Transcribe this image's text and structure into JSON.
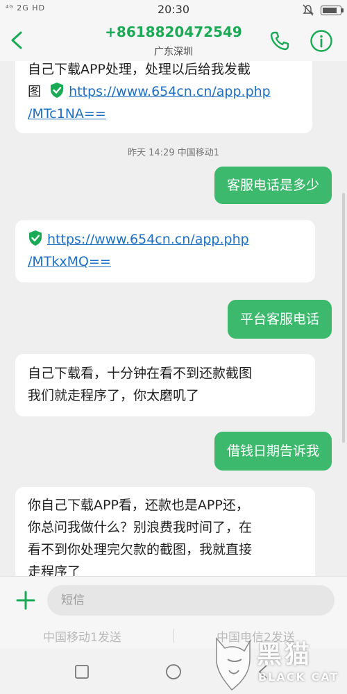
{
  "status": {
    "network": "⁴ᴳ 2G HD",
    "time": "20:30"
  },
  "header": {
    "title": "+8618820472549",
    "subtitle": "广东深圳"
  },
  "messages": [
    {
      "dir": "in",
      "lines": [
        "自己下载APP处理，处理以后给我发截"
      ],
      "link_prefix": "图",
      "link": [
        "https://www.654cn.cn/app.php",
        "/MTc1NA=="
      ]
    },
    {
      "dir": "meta",
      "text": "昨天 14:29  中国移动1"
    },
    {
      "dir": "out",
      "text": "客服电话是多少"
    },
    {
      "dir": "in",
      "link": [
        "https://www.654cn.cn/app.php",
        "/MTkxMQ=="
      ]
    },
    {
      "dir": "out",
      "text": "平台客服电话"
    },
    {
      "dir": "in",
      "lines": [
        "自己下载看，十分钟在看不到还款截图",
        "我们就走程序了，你太磨叽了"
      ]
    },
    {
      "dir": "out",
      "text": "借钱日期告诉我"
    },
    {
      "dir": "in",
      "lines": [
        "你自己下载APP看，还款也是APP还，",
        "你总问我做什么？别浪费我时间了，在",
        "看不到你处理完欠款的截图，我就直接",
        "走程序了"
      ]
    }
  ],
  "input": {
    "placeholder": "短信",
    "sim1": "中国移动1发送",
    "sim2": "中国电信2发送"
  },
  "watermark": {
    "cn": "黑猫",
    "en": "BLACK CAT"
  },
  "colors": {
    "accent": "#1aaa55",
    "out_bubble": "#3cb96d",
    "link": "#1e6fc4"
  }
}
